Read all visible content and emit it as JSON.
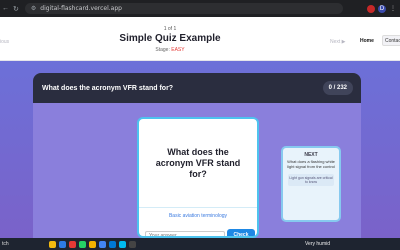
{
  "browser": {
    "url": "digital-flashcard.vercel.app"
  },
  "header": {
    "prev_label": "ious",
    "counter": "1 of 1",
    "title": "Simple Quiz Example",
    "stage_prefix": "Stage: ",
    "stage_level": "EASY",
    "next_label": "Next ▶",
    "home_label": "Home",
    "contact_label": "Contact"
  },
  "quiz": {
    "question": "What does the acronym VFR stand for?",
    "score": "0 / 232"
  },
  "card": {
    "question": "What does the acronym VFR stand for?",
    "category": "Basic aviation terminology",
    "answer_placeholder": "Your answer",
    "check_label": "Check"
  },
  "next_card": {
    "label": "NEXT",
    "question": "What does a flashing white light signal from the control",
    "hint": "Light gun signals are critical to know"
  },
  "taskbar": {
    "search_text": "tch",
    "weather": "Very humid"
  },
  "colors": {
    "accent": "#1e88e5",
    "level": "#e53935",
    "card_border": "#4ec3ee"
  }
}
